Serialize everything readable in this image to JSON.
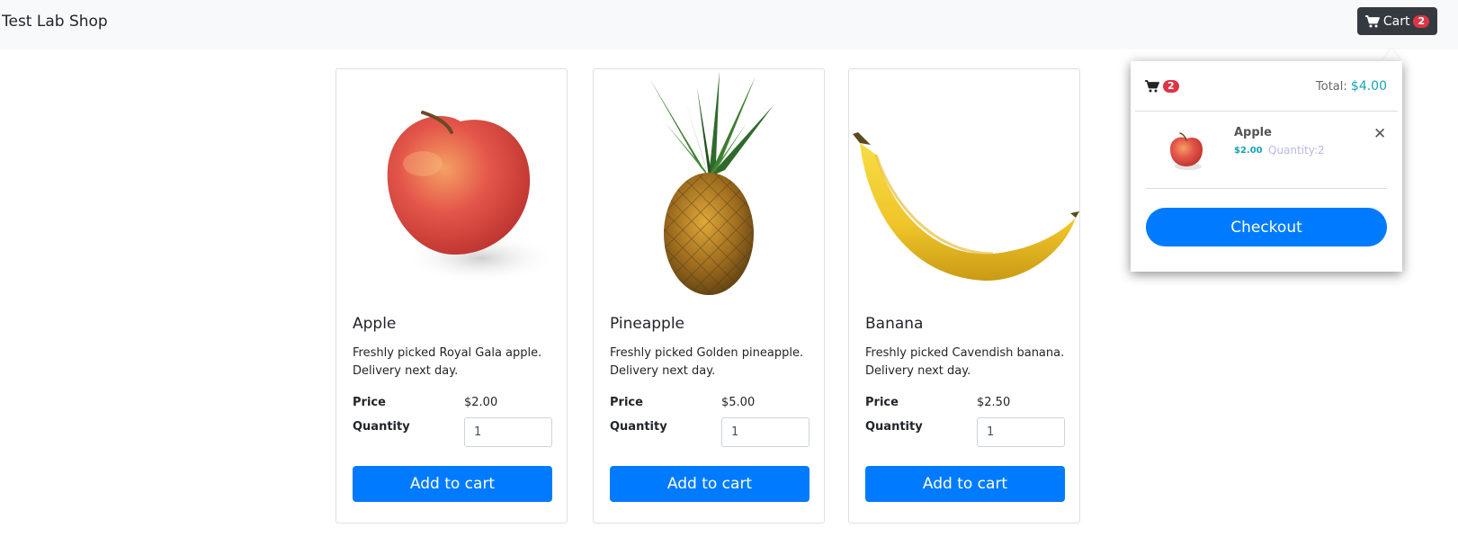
{
  "navbar": {
    "brand": "Test Lab Shop",
    "cart_label": "Cart",
    "cart_count": "2"
  },
  "products": [
    {
      "name": "Apple",
      "description": "Freshly picked Royal Gala apple. Delivery next day.",
      "price_label": "Price",
      "price": "$2.00",
      "quantity_label": "Quantity",
      "quantity": "1",
      "button": "Add to cart",
      "image_icon": "apple-image"
    },
    {
      "name": "Pineapple",
      "description": "Freshly picked Golden pineapple. Delivery next day.",
      "price_label": "Price",
      "price": "$5.00",
      "quantity_label": "Quantity",
      "quantity": "1",
      "button": "Add to cart",
      "image_icon": "pineapple-image"
    },
    {
      "name": "Banana",
      "description": "Freshly picked Cavendish banana. Delivery next day.",
      "price_label": "Price",
      "price": "$2.50",
      "quantity_label": "Quantity",
      "quantity": "1",
      "button": "Add to cart",
      "image_icon": "banana-image"
    }
  ],
  "cart_popover": {
    "count": "2",
    "total_label": "Total:",
    "total_value": "$4.00",
    "items": [
      {
        "name": "Apple",
        "price": "$2.00",
        "quantity": "Quantity:2"
      }
    ],
    "checkout_label": "Checkout"
  },
  "colors": {
    "primary": "#007bff",
    "navbar_bg": "#f8f9fa",
    "cart_button_bg": "#343a40",
    "badge": "#dc3545",
    "info": "#17a2b8"
  }
}
